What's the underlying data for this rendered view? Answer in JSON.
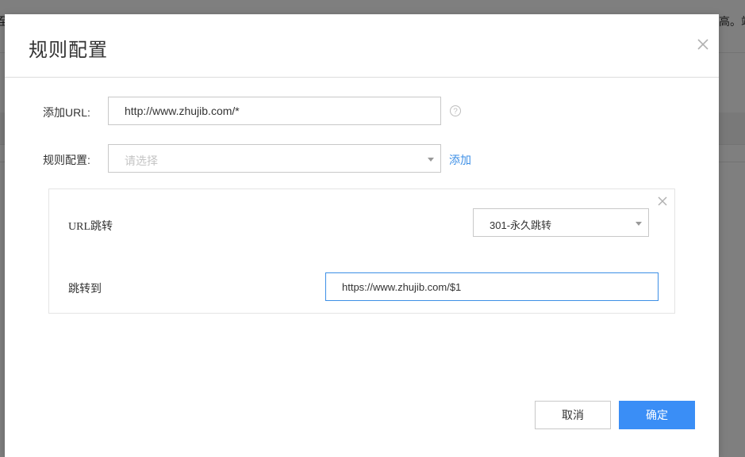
{
  "background": {
    "text_right": "高。站",
    "text_left": "至"
  },
  "modal": {
    "title": "规则配置",
    "close_icon": "close-icon"
  },
  "form": {
    "url_label": "添加URL:",
    "url_value": "http://www.zhujib.com/*",
    "help_icon": "question-circle-icon",
    "rule_label": "规则配置:",
    "rule_placeholder": "请选择",
    "add_link": "添加"
  },
  "rule_panel": {
    "type_label": "URL跳转",
    "redirect_type": "301-永久跳转",
    "target_label": "跳转到",
    "target_value": "https://www.zhujib.com/$1"
  },
  "footer": {
    "cancel_label": "取消",
    "ok_label": "确定"
  },
  "colors": {
    "accent": "#3a8ef6",
    "link": "#3d8fe6",
    "focus_border": "#3d8fe6"
  }
}
